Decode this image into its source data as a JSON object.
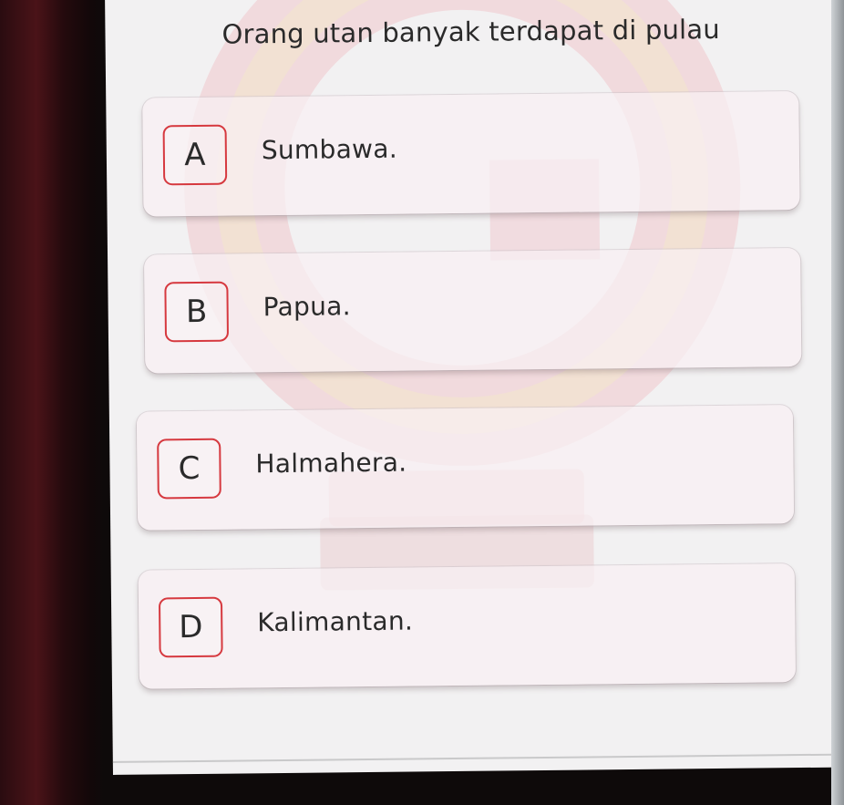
{
  "question": "Orang utan banyak terdapat di pulau",
  "options": [
    {
      "letter": "A",
      "text": "Sumbawa."
    },
    {
      "letter": "B",
      "text": "Papua."
    },
    {
      "letter": "C",
      "text": "Halmahera."
    },
    {
      "letter": "D",
      "text": "Kalimantan."
    }
  ],
  "colors": {
    "accent_border": "#d6393f",
    "text": "#2a2a2a",
    "screen_background": "#f2f1f2"
  },
  "icons": {
    "watermark": "brand-logo-watermark"
  }
}
